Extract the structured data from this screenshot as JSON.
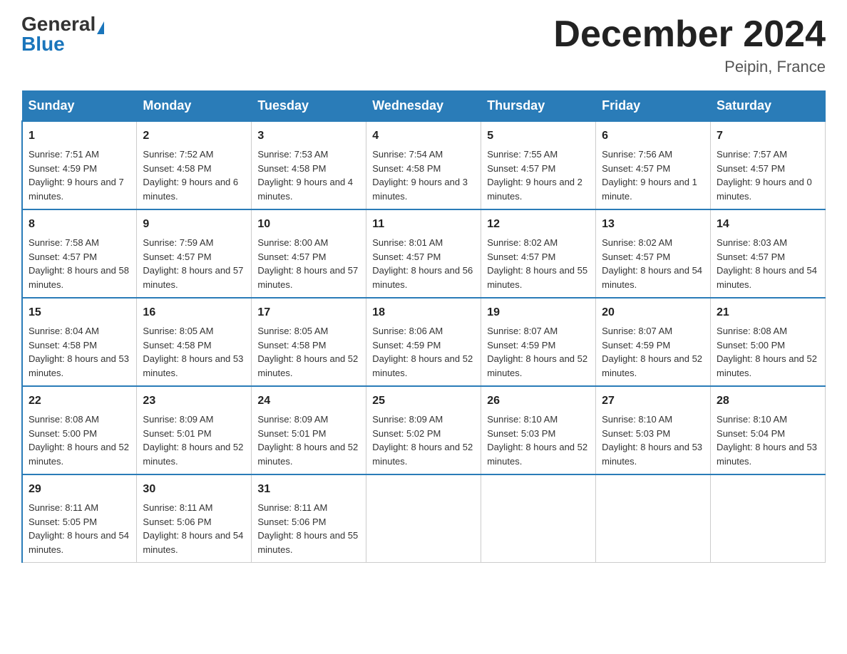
{
  "header": {
    "logo_general": "General",
    "logo_blue": "Blue",
    "title": "December 2024",
    "subtitle": "Peipin, France"
  },
  "days_of_week": [
    "Sunday",
    "Monday",
    "Tuesday",
    "Wednesday",
    "Thursday",
    "Friday",
    "Saturday"
  ],
  "weeks": [
    [
      {
        "day": "1",
        "sunrise": "7:51 AM",
        "sunset": "4:59 PM",
        "daylight": "9 hours and 7 minutes."
      },
      {
        "day": "2",
        "sunrise": "7:52 AM",
        "sunset": "4:58 PM",
        "daylight": "9 hours and 6 minutes."
      },
      {
        "day": "3",
        "sunrise": "7:53 AM",
        "sunset": "4:58 PM",
        "daylight": "9 hours and 4 minutes."
      },
      {
        "day": "4",
        "sunrise": "7:54 AM",
        "sunset": "4:58 PM",
        "daylight": "9 hours and 3 minutes."
      },
      {
        "day": "5",
        "sunrise": "7:55 AM",
        "sunset": "4:57 PM",
        "daylight": "9 hours and 2 minutes."
      },
      {
        "day": "6",
        "sunrise": "7:56 AM",
        "sunset": "4:57 PM",
        "daylight": "9 hours and 1 minute."
      },
      {
        "day": "7",
        "sunrise": "7:57 AM",
        "sunset": "4:57 PM",
        "daylight": "9 hours and 0 minutes."
      }
    ],
    [
      {
        "day": "8",
        "sunrise": "7:58 AM",
        "sunset": "4:57 PM",
        "daylight": "8 hours and 58 minutes."
      },
      {
        "day": "9",
        "sunrise": "7:59 AM",
        "sunset": "4:57 PM",
        "daylight": "8 hours and 57 minutes."
      },
      {
        "day": "10",
        "sunrise": "8:00 AM",
        "sunset": "4:57 PM",
        "daylight": "8 hours and 57 minutes."
      },
      {
        "day": "11",
        "sunrise": "8:01 AM",
        "sunset": "4:57 PM",
        "daylight": "8 hours and 56 minutes."
      },
      {
        "day": "12",
        "sunrise": "8:02 AM",
        "sunset": "4:57 PM",
        "daylight": "8 hours and 55 minutes."
      },
      {
        "day": "13",
        "sunrise": "8:02 AM",
        "sunset": "4:57 PM",
        "daylight": "8 hours and 54 minutes."
      },
      {
        "day": "14",
        "sunrise": "8:03 AM",
        "sunset": "4:57 PM",
        "daylight": "8 hours and 54 minutes."
      }
    ],
    [
      {
        "day": "15",
        "sunrise": "8:04 AM",
        "sunset": "4:58 PM",
        "daylight": "8 hours and 53 minutes."
      },
      {
        "day": "16",
        "sunrise": "8:05 AM",
        "sunset": "4:58 PM",
        "daylight": "8 hours and 53 minutes."
      },
      {
        "day": "17",
        "sunrise": "8:05 AM",
        "sunset": "4:58 PM",
        "daylight": "8 hours and 52 minutes."
      },
      {
        "day": "18",
        "sunrise": "8:06 AM",
        "sunset": "4:59 PM",
        "daylight": "8 hours and 52 minutes."
      },
      {
        "day": "19",
        "sunrise": "8:07 AM",
        "sunset": "4:59 PM",
        "daylight": "8 hours and 52 minutes."
      },
      {
        "day": "20",
        "sunrise": "8:07 AM",
        "sunset": "4:59 PM",
        "daylight": "8 hours and 52 minutes."
      },
      {
        "day": "21",
        "sunrise": "8:08 AM",
        "sunset": "5:00 PM",
        "daylight": "8 hours and 52 minutes."
      }
    ],
    [
      {
        "day": "22",
        "sunrise": "8:08 AM",
        "sunset": "5:00 PM",
        "daylight": "8 hours and 52 minutes."
      },
      {
        "day": "23",
        "sunrise": "8:09 AM",
        "sunset": "5:01 PM",
        "daylight": "8 hours and 52 minutes."
      },
      {
        "day": "24",
        "sunrise": "8:09 AM",
        "sunset": "5:01 PM",
        "daylight": "8 hours and 52 minutes."
      },
      {
        "day": "25",
        "sunrise": "8:09 AM",
        "sunset": "5:02 PM",
        "daylight": "8 hours and 52 minutes."
      },
      {
        "day": "26",
        "sunrise": "8:10 AM",
        "sunset": "5:03 PM",
        "daylight": "8 hours and 52 minutes."
      },
      {
        "day": "27",
        "sunrise": "8:10 AM",
        "sunset": "5:03 PM",
        "daylight": "8 hours and 53 minutes."
      },
      {
        "day": "28",
        "sunrise": "8:10 AM",
        "sunset": "5:04 PM",
        "daylight": "8 hours and 53 minutes."
      }
    ],
    [
      {
        "day": "29",
        "sunrise": "8:11 AM",
        "sunset": "5:05 PM",
        "daylight": "8 hours and 54 minutes."
      },
      {
        "day": "30",
        "sunrise": "8:11 AM",
        "sunset": "5:06 PM",
        "daylight": "8 hours and 54 minutes."
      },
      {
        "day": "31",
        "sunrise": "8:11 AM",
        "sunset": "5:06 PM",
        "daylight": "8 hours and 55 minutes."
      },
      null,
      null,
      null,
      null
    ]
  ],
  "labels": {
    "sunrise": "Sunrise:",
    "sunset": "Sunset:",
    "daylight": "Daylight:"
  }
}
